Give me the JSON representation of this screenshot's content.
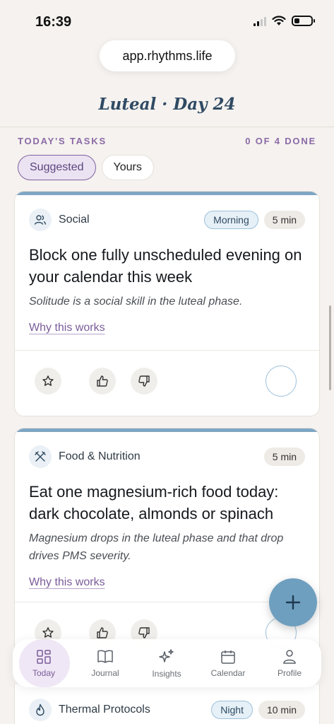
{
  "status_bar": {
    "time": "16:39"
  },
  "browser": {
    "url": "app.rhythms.life"
  },
  "phase_title": "Luteal · Day 24",
  "tasks": {
    "label": "TODAY'S TASKS",
    "count": "0 OF 4 DONE",
    "tabs": [
      {
        "label": "Suggested",
        "active": true
      },
      {
        "label": "Yours",
        "active": false
      }
    ]
  },
  "cards": [
    {
      "category": "Social",
      "category_icon": "people-icon",
      "time_of_day": "Morning",
      "duration": "5 min",
      "title": "Block one fully unscheduled evening on your calendar this week",
      "subtitle": "Solitude is a social skill in the luteal phase.",
      "link": "Why this works"
    },
    {
      "category": "Food & Nutrition",
      "category_icon": "utensils-icon",
      "duration": "5 min",
      "title": "Eat one magnesium-rich food today: dark chocolate, almonds or spinach",
      "subtitle": "Magnesium drops in the luteal phase and that drop drives PMS severity.",
      "link": "Why this works"
    },
    {
      "category": "Thermal Protocols",
      "category_icon": "flame-icon",
      "time_of_day": "Night",
      "duration": "10 min"
    }
  ],
  "nav": [
    {
      "label": "Today",
      "icon": "grid-icon",
      "active": true
    },
    {
      "label": "Journal",
      "icon": "book-icon",
      "active": false
    },
    {
      "label": "Insights",
      "icon": "sparkles-icon",
      "active": false
    },
    {
      "label": "Calendar",
      "icon": "calendar-icon",
      "active": false
    },
    {
      "label": "Profile",
      "icon": "person-icon",
      "active": false
    }
  ],
  "colors": {
    "background": "#f5f2ef",
    "accent_purple": "#7e63a0",
    "accent_blue": "#7fa6c3",
    "fab": "#6f9fbf",
    "title_navy": "#2f4a63"
  }
}
